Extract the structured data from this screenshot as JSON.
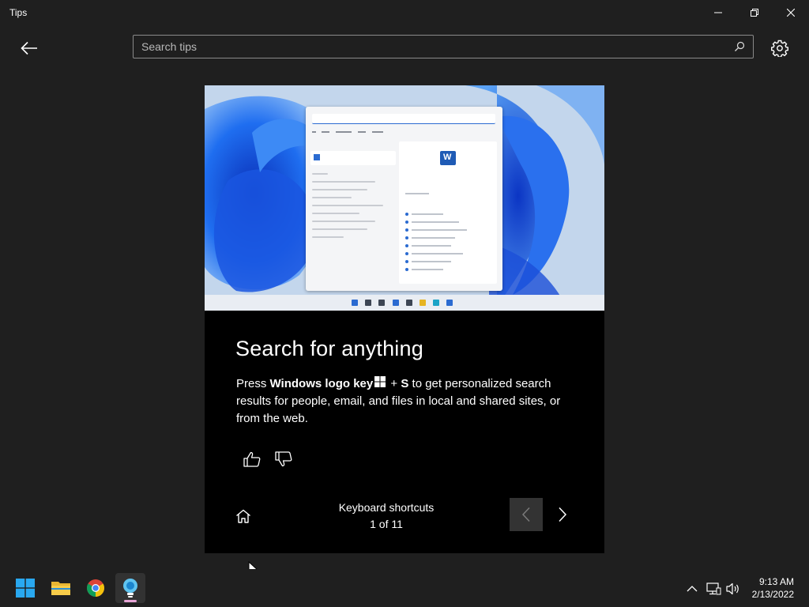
{
  "window": {
    "title": "Tips"
  },
  "header": {
    "search_placeholder": "Search tips"
  },
  "tip": {
    "title": "Search for anything",
    "body_press": "Press",
    "body_key": "Windows logo key",
    "body_plus": "+",
    "body_s": "S",
    "body_rest": "to get personalized search results for people, email, and files in local and shared sites, or from the web."
  },
  "footer": {
    "collection_name": "Keyboard shortcuts",
    "position": "1 of 11"
  },
  "clock": {
    "time": "9:13 AM",
    "date": "2/13/2022"
  },
  "taskbar": {
    "apps": [
      "start-icon",
      "file-explorer-icon",
      "chrome-icon",
      "tips-icon"
    ]
  },
  "colors": {
    "background": "#1f1f1f",
    "card": "#000000",
    "accent_indicator": "#e7a5d6"
  }
}
